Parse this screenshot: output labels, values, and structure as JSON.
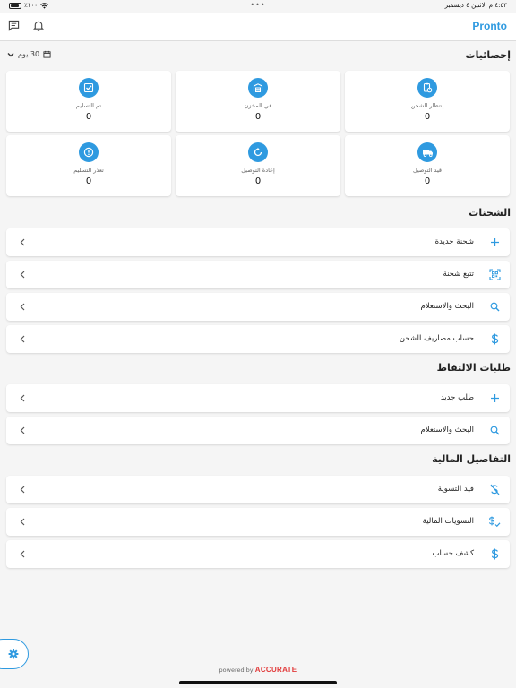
{
  "status_bar": {
    "time_date": "٤:٥٣ م   الاثنين ٤ ديسمبر",
    "battery": "٪١٠٠",
    "dots": "•••"
  },
  "app": {
    "brand": "Pronto",
    "accent": "#2f9ae0"
  },
  "stats": {
    "title": "إحصائيات",
    "range": "30 يوم",
    "cards": [
      {
        "label": "إنتظار الشحن",
        "value": "0",
        "icon": "clipboard-clock-icon"
      },
      {
        "label": "في المخزن",
        "value": "0",
        "icon": "warehouse-icon"
      },
      {
        "label": "تم التسليم",
        "value": "0",
        "icon": "check-box-icon"
      },
      {
        "label": "قيد التوصيل",
        "value": "0",
        "icon": "truck-icon"
      },
      {
        "label": "إعادة التوصيل",
        "value": "0",
        "icon": "refresh-icon"
      },
      {
        "label": "تعذر التسليم",
        "value": "0",
        "icon": "alert-icon"
      }
    ]
  },
  "shipments": {
    "title": "الشحنات",
    "items": [
      {
        "label": "شحنة جديدة",
        "icon": "plus-icon"
      },
      {
        "label": "تتبع شحنة",
        "icon": "scan-icon"
      },
      {
        "label": "البحث والاستعلام",
        "icon": "search-icon"
      },
      {
        "label": "حساب مصاريف الشحن",
        "icon": "dollar-icon"
      }
    ]
  },
  "pickups": {
    "title": "طلبات الالتقاط",
    "items": [
      {
        "label": "طلب جديد",
        "icon": "plus-icon"
      },
      {
        "label": "البحث والاستعلام",
        "icon": "search-icon"
      }
    ]
  },
  "finance": {
    "title": "التفاصيل المالية",
    "items": [
      {
        "label": "قيد التسوية",
        "icon": "money-off-icon"
      },
      {
        "label": "التسويات المالية",
        "icon": "dollar-check-icon"
      },
      {
        "label": "كشف حساب",
        "icon": "dollar-icon"
      }
    ]
  },
  "footer": {
    "powered_by": "powered by",
    "brand": "ACCURATE"
  }
}
